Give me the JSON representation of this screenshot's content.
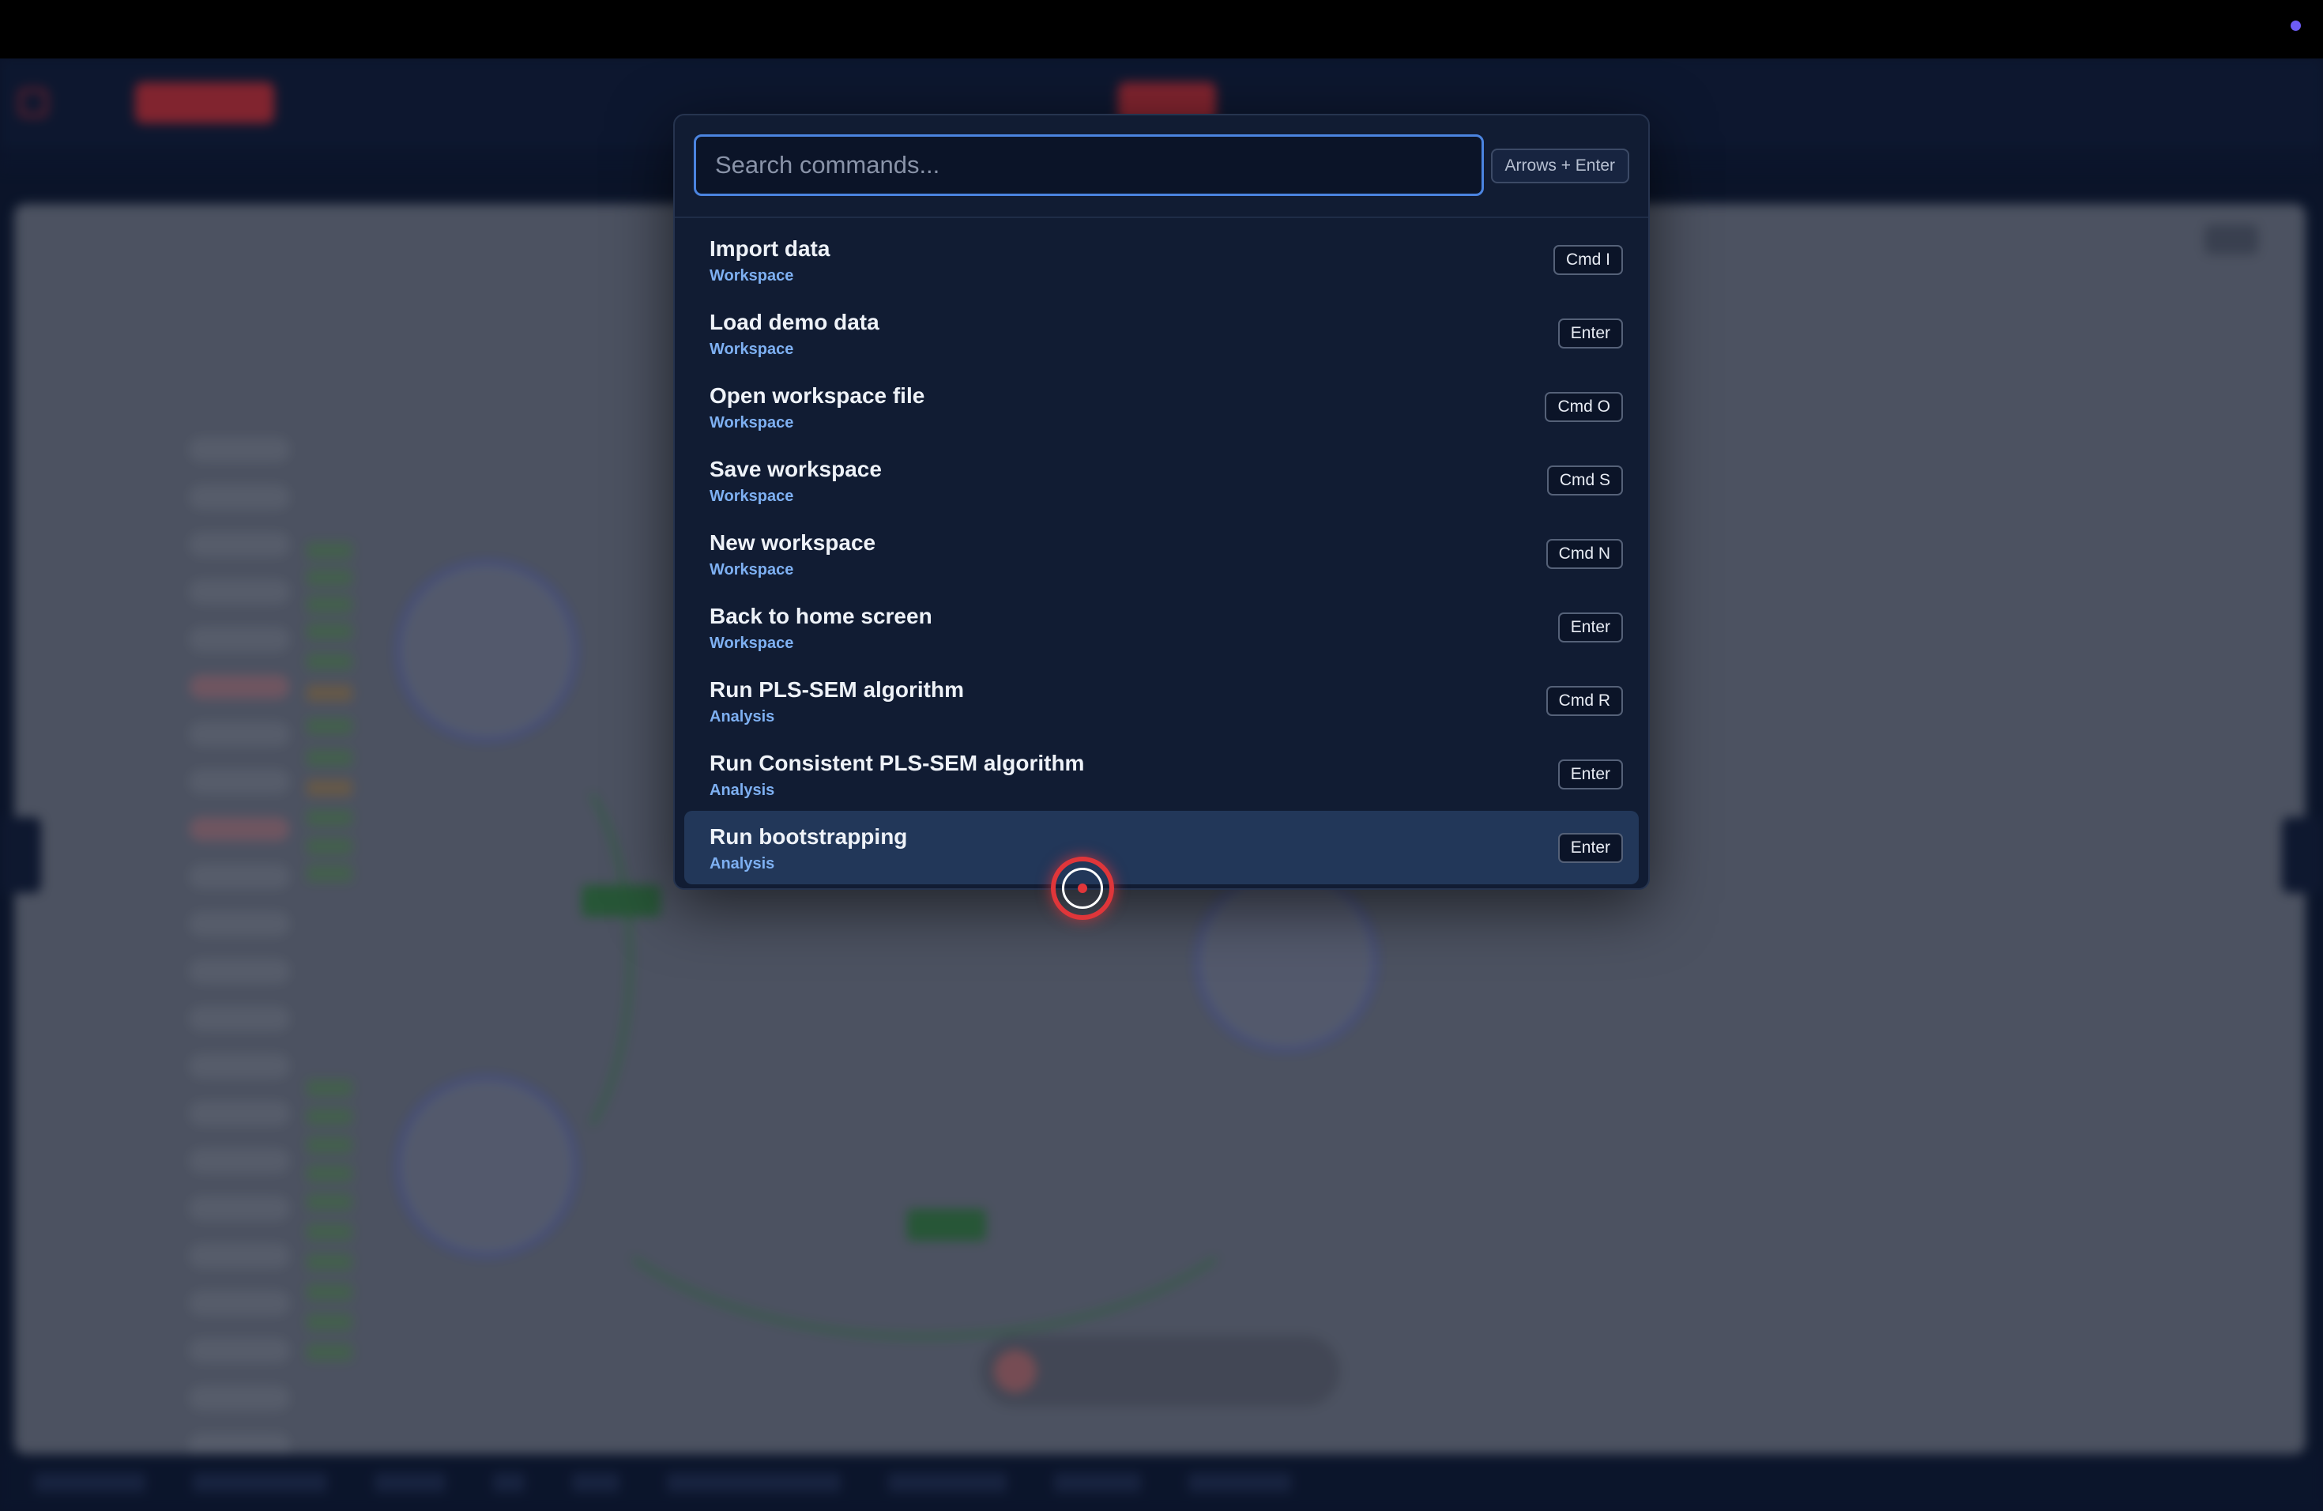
{
  "search": {
    "placeholder": "Search commands...",
    "hint": "Arrows + Enter"
  },
  "commands": [
    {
      "label": "Import data",
      "category": "Workspace",
      "shortcut": "Cmd I"
    },
    {
      "label": "Load demo data",
      "category": "Workspace",
      "shortcut": "Enter"
    },
    {
      "label": "Open workspace file",
      "category": "Workspace",
      "shortcut": "Cmd O"
    },
    {
      "label": "Save workspace",
      "category": "Workspace",
      "shortcut": "Cmd S"
    },
    {
      "label": "New workspace",
      "category": "Workspace",
      "shortcut": "Cmd N"
    },
    {
      "label": "Back to home screen",
      "category": "Workspace",
      "shortcut": "Enter"
    },
    {
      "label": "Run PLS-SEM algorithm",
      "category": "Analysis",
      "shortcut": "Cmd R"
    },
    {
      "label": "Run Consistent PLS-SEM algorithm",
      "category": "Analysis",
      "shortcut": "Enter"
    },
    {
      "label": "Run bootstrapping",
      "category": "Analysis",
      "shortcut": "Enter"
    }
  ],
  "selected_index": 8,
  "colors": {
    "accent": "#4b84e0",
    "brand_red": "#d9363e",
    "category_text": "#7eb0f2",
    "panel_bg": "#111c33"
  },
  "icons": [
    "window-dot-icon",
    "app-logo-icon",
    "cursor-indicator-icon"
  ]
}
